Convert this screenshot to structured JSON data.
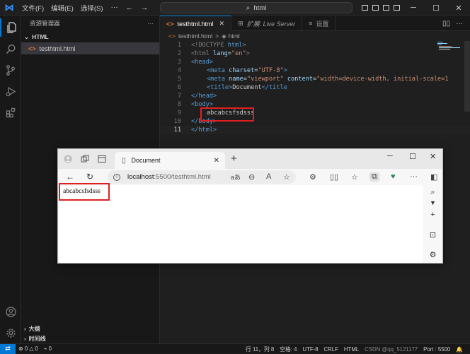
{
  "titlebar": {
    "menu": [
      "文件(F)",
      "编辑(E)",
      "选择(S)"
    ],
    "more": "···",
    "search_text": "html",
    "window_minimize": "─",
    "window_maximize": "☐",
    "window_close": "✕"
  },
  "sidebar": {
    "title": "资源管理器",
    "more": "···",
    "folder": "HTML",
    "file": "testhtml.html",
    "outline_label": "大纲",
    "timeline_label": "时间线"
  },
  "tabs": [
    {
      "label": "testhtml.html",
      "close": "✕"
    },
    {
      "label": "扩展: Live Server"
    },
    {
      "label": "设置"
    }
  ],
  "breadcrumb": {
    "file": "testhtml.html",
    "sep": ">",
    "node": "html"
  },
  "code_lines": [
    {
      "num": "1"
    },
    {
      "num": "2"
    },
    {
      "num": "3"
    },
    {
      "num": "4"
    },
    {
      "num": "5"
    },
    {
      "num": "6"
    },
    {
      "num": "7"
    },
    {
      "num": "8"
    },
    {
      "num": "9"
    },
    {
      "num": "10"
    },
    {
      "num": "11"
    }
  ],
  "code_text": {
    "l1_doctype": "<!DOCTYPE ",
    "l1_html": "html",
    "l1_end": ">",
    "l2_open": "<html ",
    "l2_attr": "lang",
    "l2_eq": "=",
    "l2_val": "\"en\"",
    "l2_end": ">",
    "l3": "<head>",
    "l4_open": "<meta ",
    "l4_attr": "charset",
    "l4_eq": "=",
    "l4_val": "\"UTF-8\"",
    "l4_end": ">",
    "l5_open": "<meta ",
    "l5_attr1": "name",
    "l5_eq1": "=",
    "l5_val1": "\"viewport\"",
    "l5_attr2": " content",
    "l5_eq2": "=",
    "l5_val2": "\"width=device-width, initial-scale=1",
    "l6_open": "<title>",
    "l6_text": "Document",
    "l6_close": "</title",
    "l7": "</head>",
    "l8": "<body>",
    "l9_text": "abcabcsfsdsss",
    "l10": "</body>",
    "l11": "</html>"
  },
  "browser": {
    "tab_title": "Document",
    "tab_close": "✕",
    "new_tab": "+",
    "minimize": "─",
    "maximize": "☐",
    "close": "✕",
    "url_host": "localhost",
    "url_path": ":5500/testhtml.html",
    "page_text": "abcabcsfsdsss",
    "more": "···"
  },
  "statusbar": {
    "errors": "⊗ 0 △ 0",
    "ports": "0",
    "position": "行 11，列 8",
    "spaces": "空格: 4",
    "encoding": "UTF-8",
    "eol": "CRLF",
    "language": "HTML",
    "watermark": "CSDN @qq_5121177",
    "port_label": "Port : 5500"
  },
  "colors": {
    "accent": "#0078d4",
    "highlight_box": "#e02020",
    "tag": "#569cd6",
    "attr": "#9cdcfe",
    "string": "#ce9178"
  }
}
